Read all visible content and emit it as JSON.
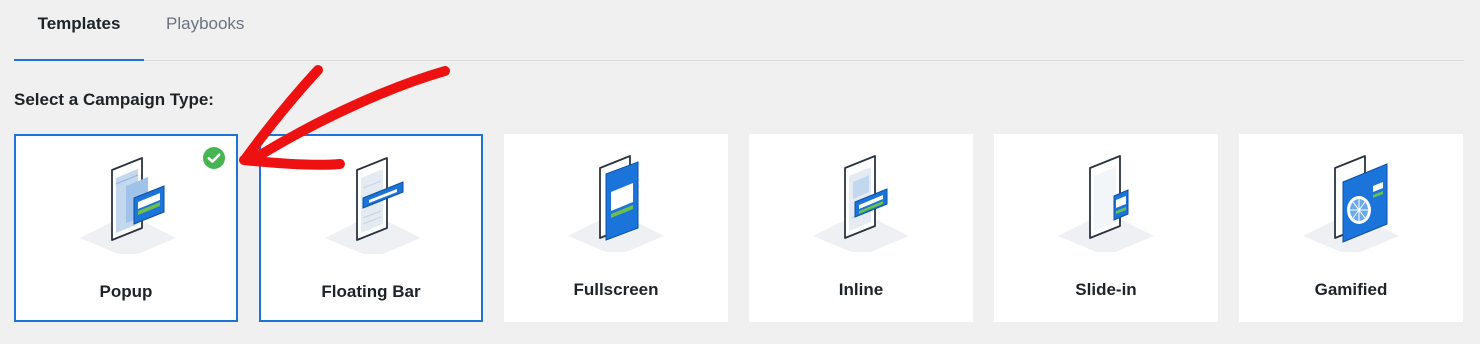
{
  "tabs": [
    {
      "label": "Templates",
      "active": true
    },
    {
      "label": "Playbooks",
      "active": false
    }
  ],
  "heading": "Select a Campaign Type:",
  "campaign_types": [
    {
      "label": "Popup",
      "icon": "popup-illustration-icon",
      "selected": true
    },
    {
      "label": "Floating Bar",
      "icon": "floating-bar-illustration-icon",
      "selected": false
    },
    {
      "label": "Fullscreen",
      "icon": "fullscreen-illustration-icon",
      "selected": false
    },
    {
      "label": "Inline",
      "icon": "inline-illustration-icon",
      "selected": false
    },
    {
      "label": "Slide-in",
      "icon": "slide-in-illustration-icon",
      "selected": false
    },
    {
      "label": "Gamified",
      "icon": "gamified-illustration-icon",
      "selected": false
    }
  ],
  "colors": {
    "accent": "#1e73d9",
    "check": "#46b450",
    "annotation": "#ee1111",
    "background": "#f0f0f0"
  }
}
